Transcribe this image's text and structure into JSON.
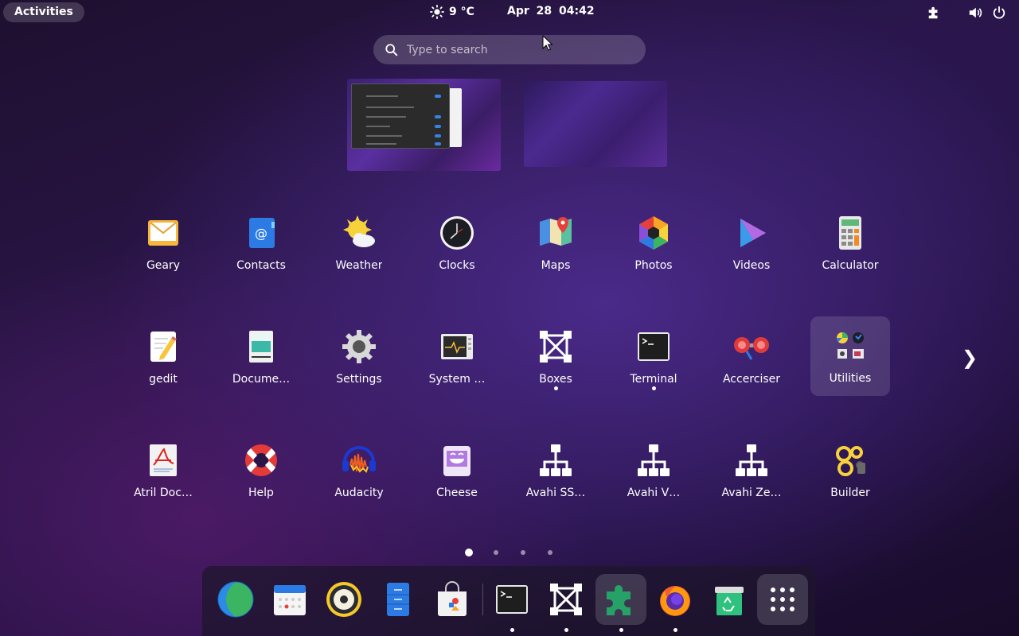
{
  "topbar": {
    "activities_label": "Activities",
    "weather_icon": "sun-icon",
    "temperature": "9 °C",
    "date": "Apr 28",
    "time": "04:42",
    "tray_icons": [
      "extensions-icon",
      "volume-icon",
      "power-icon"
    ]
  },
  "search": {
    "placeholder": "Type to search"
  },
  "workspaces": [
    "workspace-1",
    "workspace-2"
  ],
  "apps": [
    {
      "label": "Geary",
      "icon": "mail-icon"
    },
    {
      "label": "Contacts",
      "icon": "contacts-icon"
    },
    {
      "label": "Weather",
      "icon": "weather-icon"
    },
    {
      "label": "Clocks",
      "icon": "clock-icon"
    },
    {
      "label": "Maps",
      "icon": "maps-icon"
    },
    {
      "label": "Photos",
      "icon": "photos-icon"
    },
    {
      "label": "Videos",
      "icon": "videos-icon"
    },
    {
      "label": "Calculator",
      "icon": "calculator-icon"
    },
    {
      "label": "gedit",
      "icon": "text-editor-icon"
    },
    {
      "label": "Docume…",
      "icon": "document-viewer-icon"
    },
    {
      "label": "Settings",
      "icon": "gear-icon"
    },
    {
      "label": "System …",
      "icon": "system-monitor-icon"
    },
    {
      "label": "Boxes",
      "icon": "boxes-icon",
      "running": true
    },
    {
      "label": "Terminal",
      "icon": "terminal-icon",
      "running": true
    },
    {
      "label": "Accerciser",
      "icon": "accerciser-icon"
    },
    {
      "label": "Utilities",
      "icon": "folder-icon",
      "folder": true
    },
    {
      "label": "Atril Doc…",
      "icon": "atril-icon"
    },
    {
      "label": "Help",
      "icon": "lifebuoy-icon"
    },
    {
      "label": "Audacity",
      "icon": "audacity-icon"
    },
    {
      "label": "Cheese",
      "icon": "cheese-icon"
    },
    {
      "label": "Avahi SS…",
      "icon": "network-icon"
    },
    {
      "label": "Avahi V…",
      "icon": "network-icon"
    },
    {
      "label": "Avahi Ze…",
      "icon": "network-icon"
    },
    {
      "label": "Builder",
      "icon": "builder-icon"
    }
  ],
  "pager": {
    "pages": 4,
    "current": 1
  },
  "dash": [
    {
      "name": "web-browser",
      "icon": "globe-icon"
    },
    {
      "name": "calendar",
      "icon": "calendar-icon"
    },
    {
      "name": "rhythmbox",
      "icon": "speaker-icon"
    },
    {
      "name": "files",
      "icon": "file-cabinet-icon"
    },
    {
      "name": "software",
      "icon": "software-store-icon"
    },
    {
      "name": "terminal",
      "icon": "terminal-icon",
      "running": true
    },
    {
      "name": "boxes",
      "icon": "boxes-icon",
      "running": true
    },
    {
      "name": "extensions",
      "icon": "puzzle-icon",
      "running": true,
      "selected": true
    },
    {
      "name": "firefox",
      "icon": "firefox-icon",
      "running": true
    },
    {
      "name": "trash",
      "icon": "recycle-bin-icon"
    },
    {
      "name": "show-apps",
      "icon": "app-grid-icon",
      "selected": true
    }
  ]
}
